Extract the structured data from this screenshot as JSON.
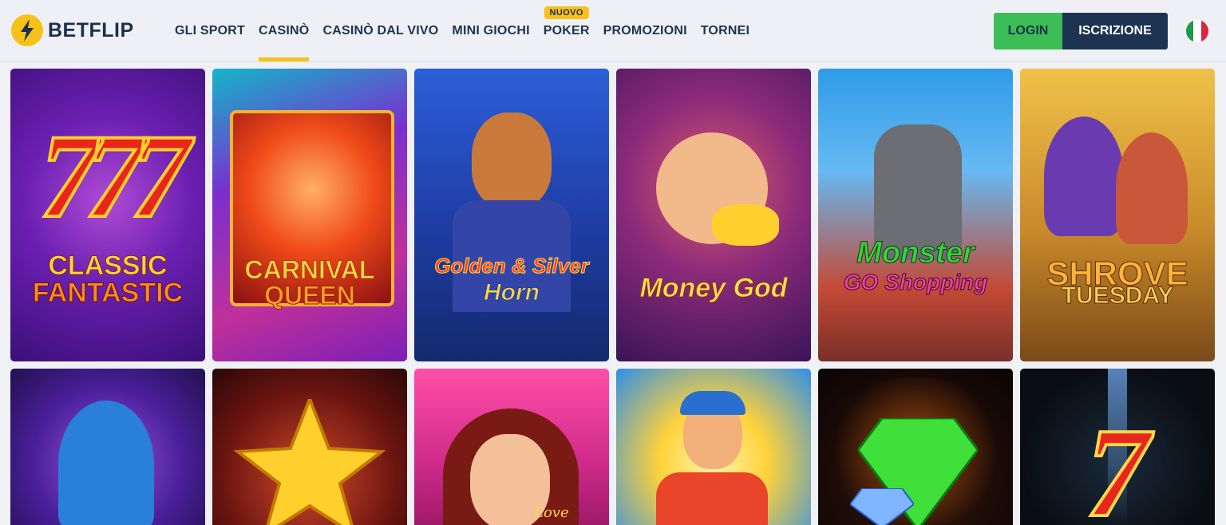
{
  "brand": {
    "name": "BETFLIP",
    "accent": "#f6c21a",
    "navy": "#1c2f4a"
  },
  "nav": {
    "items": [
      {
        "label": "GLI SPORT"
      },
      {
        "label": "CASINÒ",
        "active": true
      },
      {
        "label": "CASINÒ DAL VIVO"
      },
      {
        "label": "MINI GIOCHI"
      },
      {
        "label": "POKER",
        "badge": "NUOVO"
      },
      {
        "label": "PROMOZIONI"
      },
      {
        "label": "TORNEI"
      }
    ]
  },
  "auth": {
    "login": "LOGIN",
    "signup": "ISCRIZIONE",
    "login_color": "#3cbd55",
    "signup_color": "#1c3451"
  },
  "language": {
    "icon": "italy-flag-icon"
  },
  "games": [
    {
      "title_line1": "CLASSIC",
      "title_line2": "FANTASTIC",
      "numeral": "777"
    },
    {
      "title_line1": "CARNIVAL",
      "title_line2": "QUEEN"
    },
    {
      "title_line1": "Golden & Silver",
      "title_line2": "Horn"
    },
    {
      "title_line1": "Money",
      "title_line2": "God"
    },
    {
      "title_line1": "Monster",
      "title_line2": "GO Shopping"
    },
    {
      "title_line1": "SHROVE",
      "title_line2": "TUESDAY"
    },
    {},
    {},
    {
      "script_text": "Love"
    },
    {},
    {},
    {
      "numeral": "7"
    }
  ]
}
